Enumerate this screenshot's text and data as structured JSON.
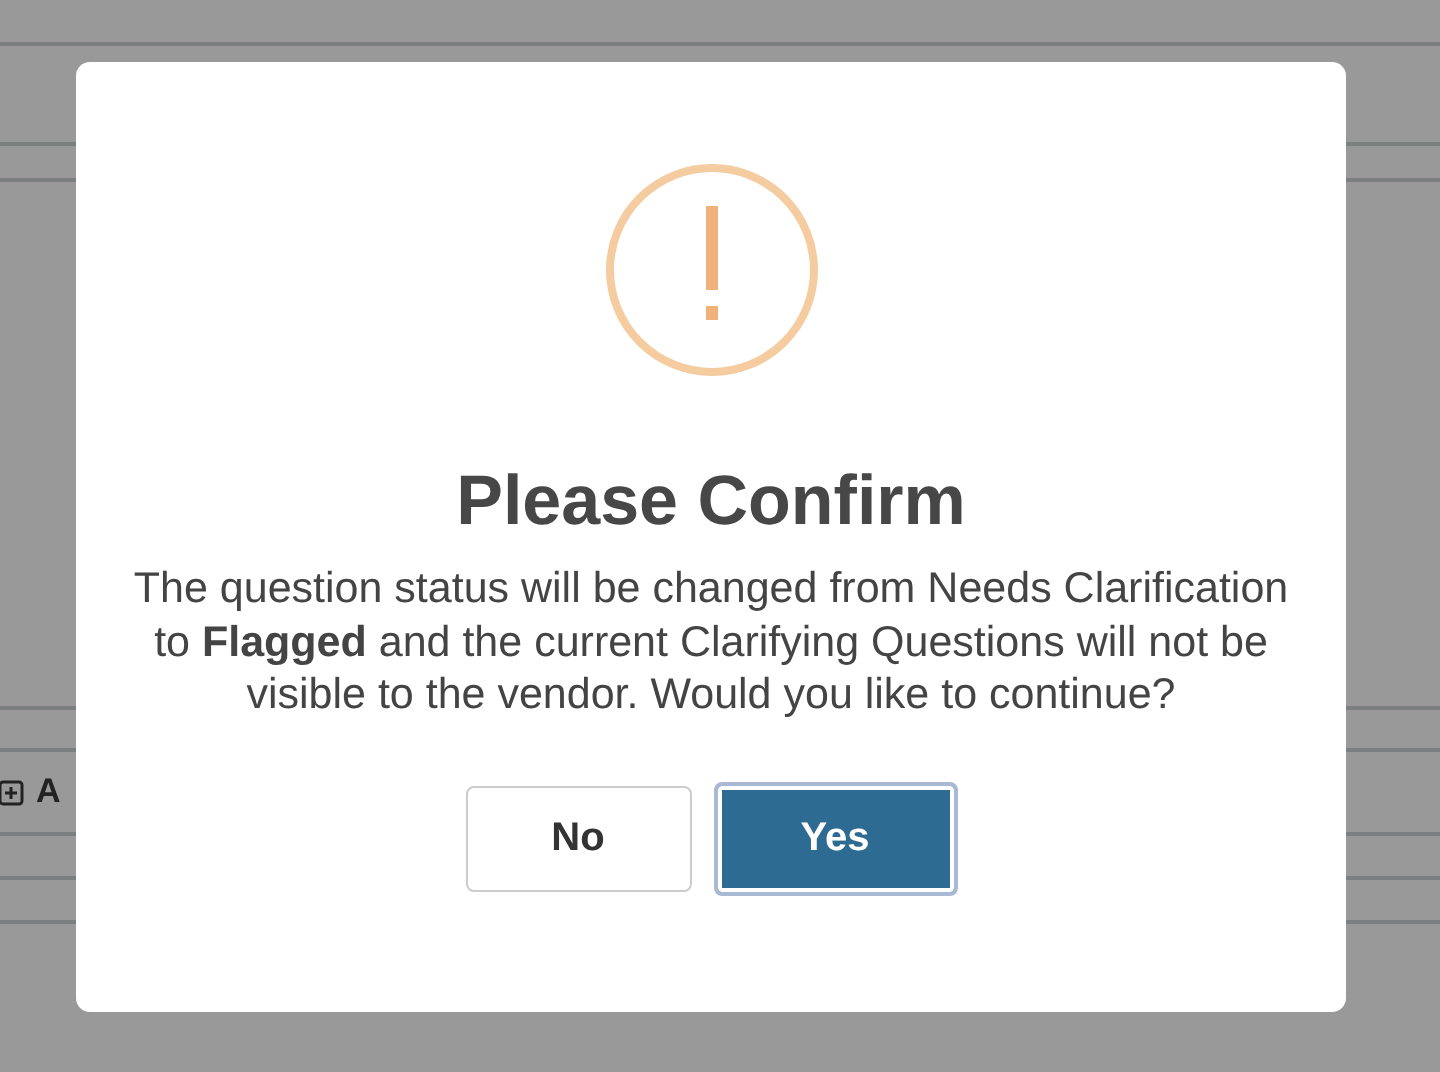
{
  "background": {
    "add_label": "A"
  },
  "dialog": {
    "title": "Please Confirm",
    "message": "The question status will be changed from Needs Clarification to **Flagged** and the current Clarifying Questions will not be visible to the vendor. Would you like to continue?",
    "buttons": [
      {
        "label": "No",
        "kind": "secondary",
        "focused": false
      },
      {
        "label": "Yes",
        "kind": "primary",
        "focused": true
      }
    ]
  }
}
